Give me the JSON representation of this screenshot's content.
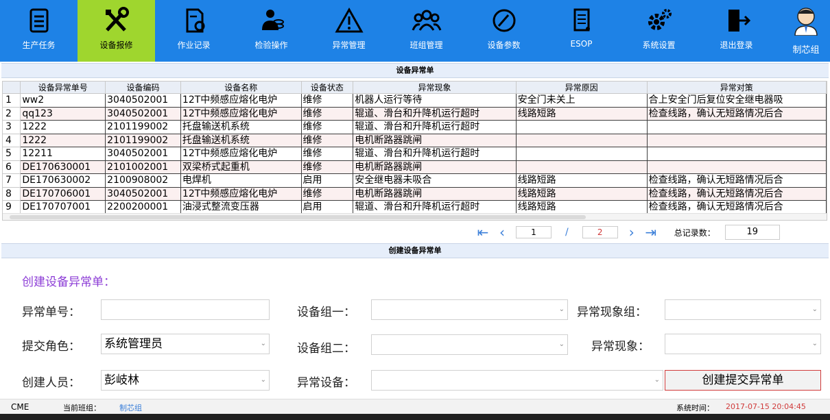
{
  "nav": {
    "items": [
      {
        "label": "生产任务",
        "icon": "clipboard-icon"
      },
      {
        "label": "设备报修",
        "icon": "tools-icon"
      },
      {
        "label": "作业记录",
        "icon": "record-icon"
      },
      {
        "label": "检验操作",
        "icon": "inspect-icon"
      },
      {
        "label": "异常管理",
        "icon": "warning-icon"
      },
      {
        "label": "班组管理",
        "icon": "team-icon"
      },
      {
        "label": "设备参数",
        "icon": "pen-icon"
      },
      {
        "label": "ESOP",
        "icon": "document-icon"
      },
      {
        "label": "系统设置",
        "icon": "gear-icon"
      },
      {
        "label": "退出登录",
        "icon": "logout-icon"
      }
    ],
    "user": "制芯组"
  },
  "grid": {
    "title": "设备异常单",
    "columns": [
      "设备异常单号",
      "设备编码",
      "设备名称",
      "设备状态",
      "异常现象",
      "异常原因",
      "异常对策"
    ],
    "rows": [
      [
        "1",
        "ww2",
        "3040502001",
        "12T中频感应熔化电炉",
        "维修",
        "机器人运行等待",
        "安全门未关上",
        "合上安全门后复位安全继电器吸"
      ],
      [
        "2",
        "qq123",
        "3040502001",
        "12T中频感应熔化电炉",
        "维修",
        "辊道、滑台和升降机运行超时",
        "线路短路",
        "检查线路，确认无短路情况后合"
      ],
      [
        "3",
        "1222",
        "2101199002",
        "托盘输送机系统",
        "维修",
        "辊道、滑台和升降机运行超时",
        "",
        ""
      ],
      [
        "4",
        "1222",
        "2101199002",
        "托盘输送机系统",
        "维修",
        "电机断路器跳闸",
        "",
        ""
      ],
      [
        "5",
        "12211",
        "3040502001",
        "12T中频感应熔化电炉",
        "维修",
        "辊道、滑台和升降机运行超时",
        "",
        ""
      ],
      [
        "6",
        "DE170630001",
        "2101002001",
        "双梁桥式起重机",
        "维修",
        "电机断路器跳闸",
        "",
        ""
      ],
      [
        "7",
        "DE170630002",
        "2100908002",
        "电焊机",
        "启用",
        "安全继电器未吸合",
        "线路短路",
        "检查线路，确认无短路情况后合"
      ],
      [
        "8",
        "DE170706001",
        "3040502001",
        "12T中频感应熔化电炉",
        "维修",
        "电机断路器跳闸",
        "线路短路",
        "检查线路，确认无短路情况后合"
      ],
      [
        "9",
        "DE170707001",
        "2200200001",
        "油浸式整流变压器",
        "启用",
        "辊道、滑台和升降机运行超时",
        "线路短路",
        "检查线路，确认无短路情况后合"
      ]
    ]
  },
  "pager": {
    "current_page": "1",
    "separator": "/",
    "total_pages": "2",
    "total_label": "总记录数：",
    "total_count": "19"
  },
  "form": {
    "section_title": "创建设备异常单",
    "title": "创建设备异常单：",
    "labels": {
      "order_no": "异常单号：",
      "role": "提交角色：",
      "creator": "创建人员：",
      "group1": "设备组一：",
      "group2": "设备组二：",
      "device": "异常设备：",
      "symptom_group": "异常现象组：",
      "symptom": "异常现象："
    },
    "values": {
      "order_no": "",
      "role": "系统管理员",
      "creator": "彭岐林",
      "group1": "",
      "group2": "",
      "device": "",
      "symptom_group": "",
      "symptom": ""
    },
    "submit_label": "创建提交异常单"
  },
  "status": {
    "app": "CME",
    "team_label": "当前班组：",
    "team": "制芯组",
    "time_label": "系统时间：",
    "time": "2017-07-15 20:04:45"
  },
  "colors": {
    "nav_bg": "#1e82e6",
    "nav_active": "#9fd62e",
    "accent_link": "#3b7fd9",
    "form_title": "#8c3cd6",
    "page_red": "#d03a3a"
  }
}
